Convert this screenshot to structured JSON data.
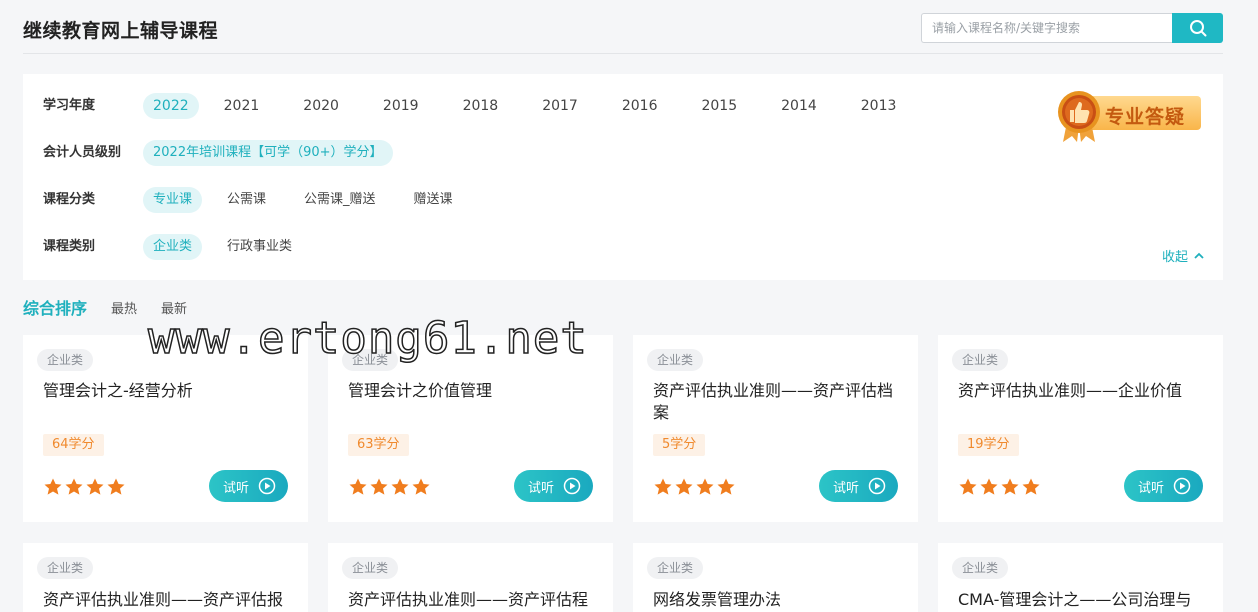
{
  "header": {
    "title": "继续教育网上辅导课程",
    "search_placeholder": "请输入课程名称/关键字搜索",
    "search_icon": "search-icon"
  },
  "filters": {
    "year": {
      "label": "学习年度",
      "options": [
        "2022",
        "2021",
        "2020",
        "2019",
        "2018",
        "2017",
        "2016",
        "2015",
        "2014",
        "2013"
      ],
      "selected": "2022"
    },
    "level": {
      "label": "会计人员级别",
      "options": [
        "2022年培训课程【可学（90+）学分】"
      ],
      "selected": "2022年培训课程【可学（90+）学分】"
    },
    "category": {
      "label": "课程分类",
      "options": [
        "专业课",
        "公需课",
        "公需课_赠送",
        "赠送课"
      ],
      "selected": "专业课"
    },
    "type": {
      "label": "课程类别",
      "options": [
        "企业类",
        "行政事业类"
      ],
      "selected": "企业类"
    },
    "collapse_label": "收起"
  },
  "qa_badge": {
    "label": "专业答疑",
    "icon": "thumbs-up-medal-icon"
  },
  "sort": {
    "options": [
      "综合排序",
      "最热",
      "最新"
    ],
    "selected": "综合排序"
  },
  "watermark": "www.ertong61.net",
  "courses": [
    {
      "tag": "企业类",
      "title": "管理会计之-经营分析",
      "credits": "64学分",
      "rating": 4,
      "button": "试听"
    },
    {
      "tag": "企业类",
      "title": "管理会计之价值管理",
      "credits": "63学分",
      "rating": 4,
      "button": "试听"
    },
    {
      "tag": "企业类",
      "title": "资产评估执业准则——资产评估档案",
      "credits": "5学分",
      "rating": 4,
      "button": "试听"
    },
    {
      "tag": "企业类",
      "title": "资产评估执业准则——企业价值",
      "credits": "19学分",
      "rating": 4,
      "button": "试听"
    },
    {
      "tag": "企业类",
      "title": "资产评估执业准则——资产评估报"
    },
    {
      "tag": "企业类",
      "title": "资产评估执业准则——资产评估程"
    },
    {
      "tag": "企业类",
      "title": "网络发票管理办法"
    },
    {
      "tag": "企业类",
      "title": "CMA-管理会计之——公司治理与"
    }
  ],
  "colors": {
    "accent": "#1fb8c4",
    "credit": "#f08a2e",
    "star": "#f07d1e"
  }
}
